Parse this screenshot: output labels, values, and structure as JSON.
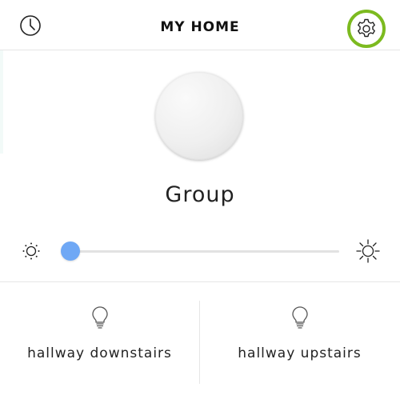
{
  "header": {
    "title": "MY HOME",
    "history_icon": "clock-icon",
    "settings_icon": "gear-icon",
    "settings_highlight_color": "#7cba1f"
  },
  "group": {
    "name": "Group",
    "color": "#eeeeee"
  },
  "brightness": {
    "min_icon": "sun-dim-icon",
    "max_icon": "sun-bright-icon",
    "level": 0.02,
    "thumb_color": "#6fa8f5"
  },
  "lights": [
    {
      "label": "hallway downstairs",
      "icon": "bulb-icon"
    },
    {
      "label": "hallway upstairs",
      "icon": "bulb-icon"
    }
  ]
}
